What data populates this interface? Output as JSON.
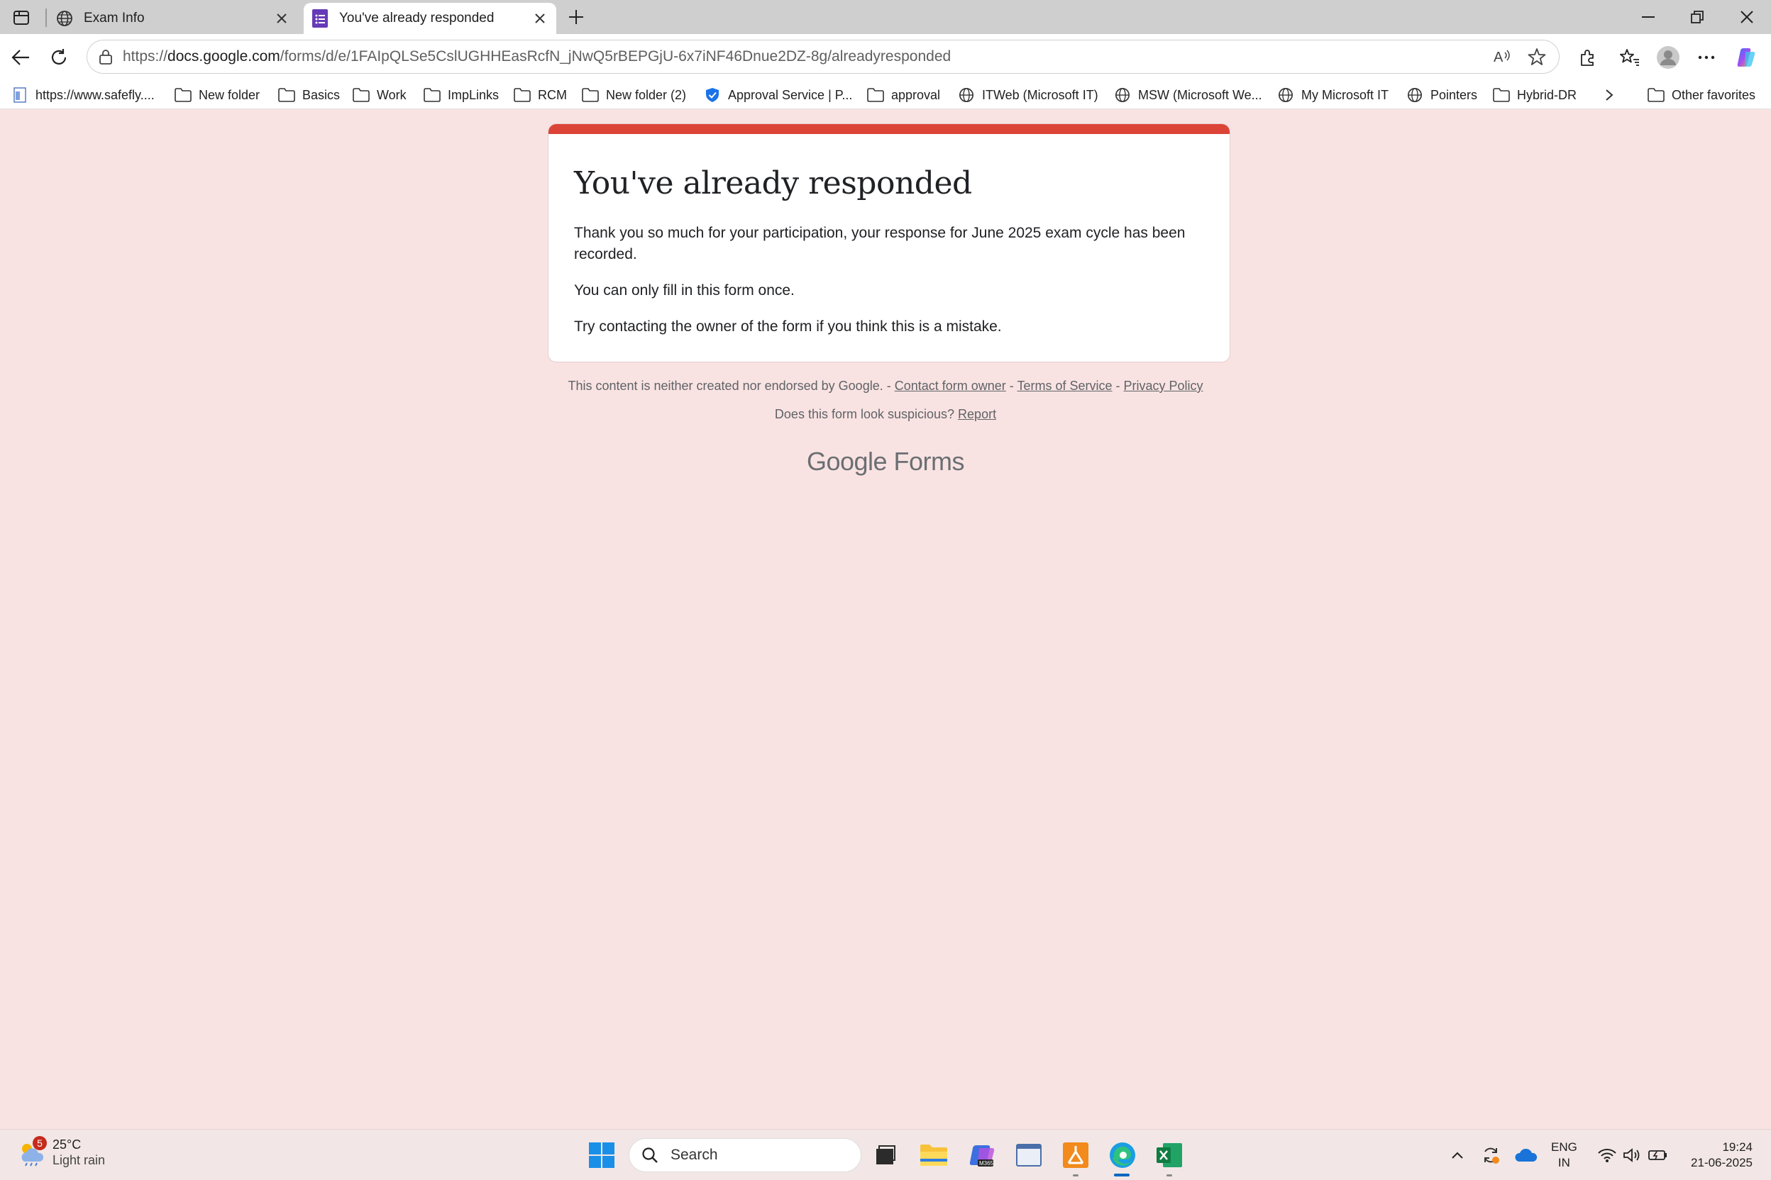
{
  "browser": {
    "tabs": [
      {
        "title": "Exam Info",
        "active": false
      },
      {
        "title": "You've already responded",
        "active": true
      }
    ],
    "url": {
      "prefix": "https://",
      "host": "docs.google.com",
      "path": "/forms/d/e/1FAIpQLSe5CslUGHHEasRcfN_jNwQ5rBEPGjU-6x7iNF46Dnue2DZ-8g/alreadyresponded"
    },
    "favorites": [
      {
        "label": "https://www.safefly....",
        "icon": "page-icon"
      },
      {
        "label": "New folder",
        "icon": "folder-icon"
      },
      {
        "label": "Basics",
        "icon": "folder-icon"
      },
      {
        "label": "Work",
        "icon": "folder-icon"
      },
      {
        "label": "ImpLinks",
        "icon": "folder-icon"
      },
      {
        "label": "RCM",
        "icon": "folder-icon"
      },
      {
        "label": "New folder (2)",
        "icon": "folder-icon"
      },
      {
        "label": "Approval Service | P...",
        "icon": "shield-check-icon"
      },
      {
        "label": "approval",
        "icon": "folder-icon"
      },
      {
        "label": "ITWeb (Microsoft IT)",
        "icon": "globe-icon"
      },
      {
        "label": "MSW (Microsoft We...",
        "icon": "globe-icon"
      },
      {
        "label": "My Microsoft IT",
        "icon": "globe-icon"
      },
      {
        "label": "Pointers",
        "icon": "globe-icon"
      },
      {
        "label": "Hybrid-DR",
        "icon": "folder-icon"
      }
    ],
    "other_favorites": "Other favorites"
  },
  "form": {
    "title": "You've already responded",
    "message1": "Thank you so much for your participation, your response for June 2025 exam cycle has been recorded.",
    "message2": "You can only fill in this form once.",
    "message3": "Try contacting the owner of the form if you think this is a mistake.",
    "accent_color": "#db4437",
    "background_color": "#f9e3e2"
  },
  "footer": {
    "disclaimer": "This content is neither created nor endorsed by Google.",
    "sep": " - ",
    "contact": "Contact form owner",
    "terms": "Terms of Service",
    "privacy": "Privacy Policy",
    "suspicious": "Does this form look suspicious?",
    "report": "Report",
    "brand_google": "Google",
    "brand_forms": "Forms"
  },
  "taskbar": {
    "weather_temp": "25°C",
    "weather_cond": "Light rain",
    "weather_badge": "5",
    "search_placeholder": "Search",
    "lang_line1": "ENG",
    "lang_line2": "IN",
    "time": "19:24",
    "date": "21-06-2025"
  }
}
